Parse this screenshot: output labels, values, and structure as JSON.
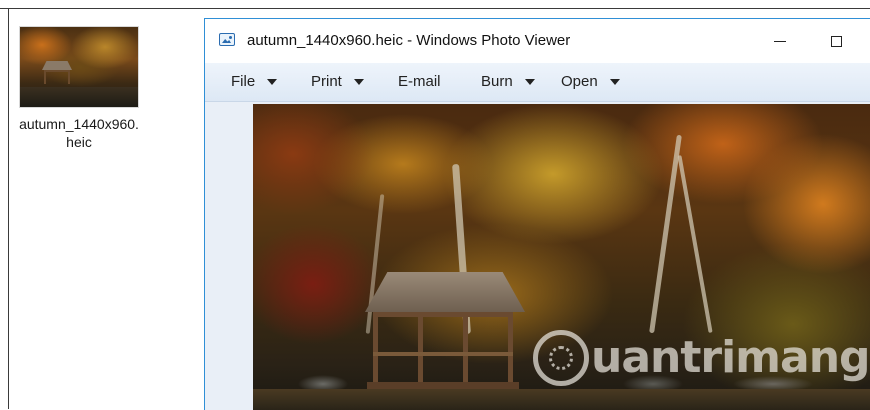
{
  "desktop": {
    "file_label": "autumn_1440x960.heic"
  },
  "window": {
    "title": "autumn_1440x960.heic - Windows Photo Viewer"
  },
  "menu": {
    "items": [
      {
        "label": "File",
        "has_dropdown": true
      },
      {
        "label": "Print",
        "has_dropdown": true
      },
      {
        "label": "E-mail",
        "has_dropdown": false
      },
      {
        "label": "Burn",
        "has_dropdown": true
      },
      {
        "label": "Open",
        "has_dropdown": true
      }
    ]
  },
  "photo": {
    "watermark_text": "uantrimang"
  },
  "colors": {
    "window_border": "#2f8fd6",
    "menubar": "#dde8f5",
    "viewer_background": "#e9eff7"
  }
}
